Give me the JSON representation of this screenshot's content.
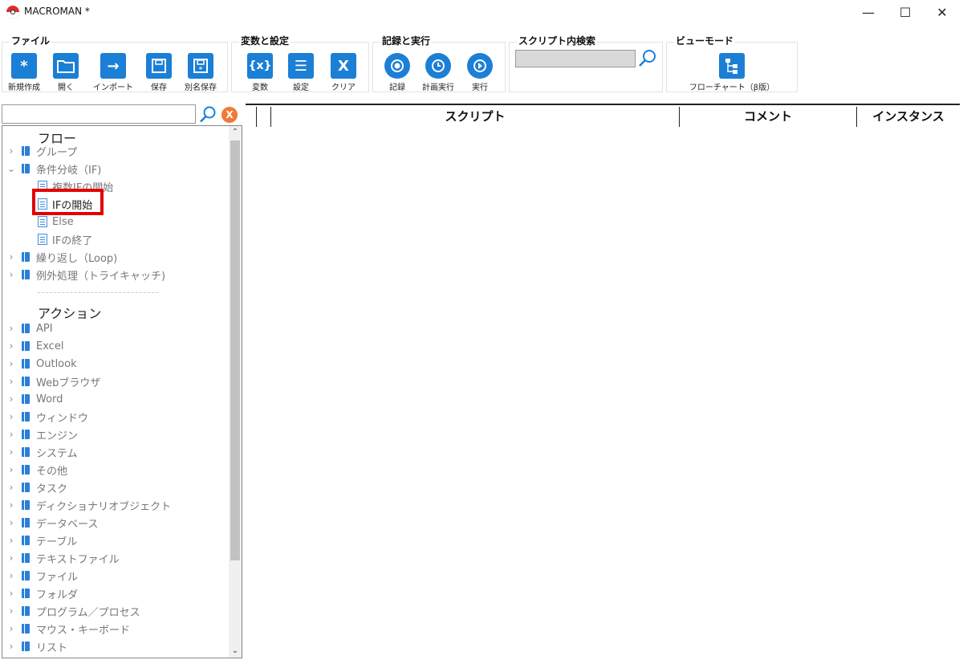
{
  "window": {
    "title": "MACROMAN *"
  },
  "ribbon": {
    "groups": [
      {
        "title": "ファイル",
        "buttons": [
          {
            "label": "新規作成",
            "glyph": "*",
            "icon": "asterisk-icon"
          },
          {
            "label": "開く",
            "glyph": "",
            "icon": "folder-icon"
          },
          {
            "label": "インポート",
            "glyph": "→",
            "icon": "arrow-right-icon"
          },
          {
            "label": "保存",
            "glyph": "",
            "icon": "save-icon"
          },
          {
            "label": "別名保存",
            "glyph": "",
            "icon": "save-as-icon"
          }
        ]
      },
      {
        "title": "変数と設定",
        "buttons": [
          {
            "label": "変数",
            "glyph": "{x}",
            "icon": "variable-icon"
          },
          {
            "label": "設定",
            "glyph": "☰",
            "icon": "list-icon"
          },
          {
            "label": "クリア",
            "glyph": "X",
            "icon": "clear-icon"
          }
        ]
      },
      {
        "title": "記録と実行",
        "buttons": [
          {
            "label": "記録",
            "glyph": "",
            "icon": "record-icon"
          },
          {
            "label": "計画実行",
            "glyph": "",
            "icon": "schedule-icon"
          },
          {
            "label": "実行",
            "glyph": "",
            "icon": "play-icon"
          }
        ]
      },
      {
        "title": "スクリプト内検索"
      },
      {
        "title": "ビューモード",
        "buttons": [
          {
            "label": "フローチャート（β版）",
            "glyph": "",
            "icon": "flowchart-icon"
          }
        ]
      }
    ]
  },
  "tree": {
    "flow_heading": "フロー",
    "flow_items": [
      {
        "label": "グループ",
        "expanded": false
      },
      {
        "label": "条件分岐（IF)",
        "expanded": true
      }
    ],
    "if_children": [
      "複数IFの開始",
      "IFの開始",
      "Else",
      "IFの終了"
    ],
    "flow_items_after": [
      "繰り返し（Loop)",
      "例外処理（トライキャッチ)"
    ],
    "action_heading": "アクション",
    "action_items": [
      "API",
      "Excel",
      "Outlook",
      "Webブラウザ",
      "Word",
      "ウィンドウ",
      "エンジン",
      "システム",
      "その他",
      "タスク",
      "ディクショナリオブジェクト",
      "データベース",
      "テーブル",
      "テキストファイル",
      "ファイル",
      "フォルダ",
      "プログラム／プロセス",
      "マウス・キーボード",
      "リスト"
    ]
  },
  "grid": {
    "columns": [
      "スクリプト",
      "コメント",
      "インスタンス"
    ]
  },
  "colors": {
    "accent": "#1b7fd6",
    "highlight": "#e50000",
    "clear": "#f07a38"
  }
}
